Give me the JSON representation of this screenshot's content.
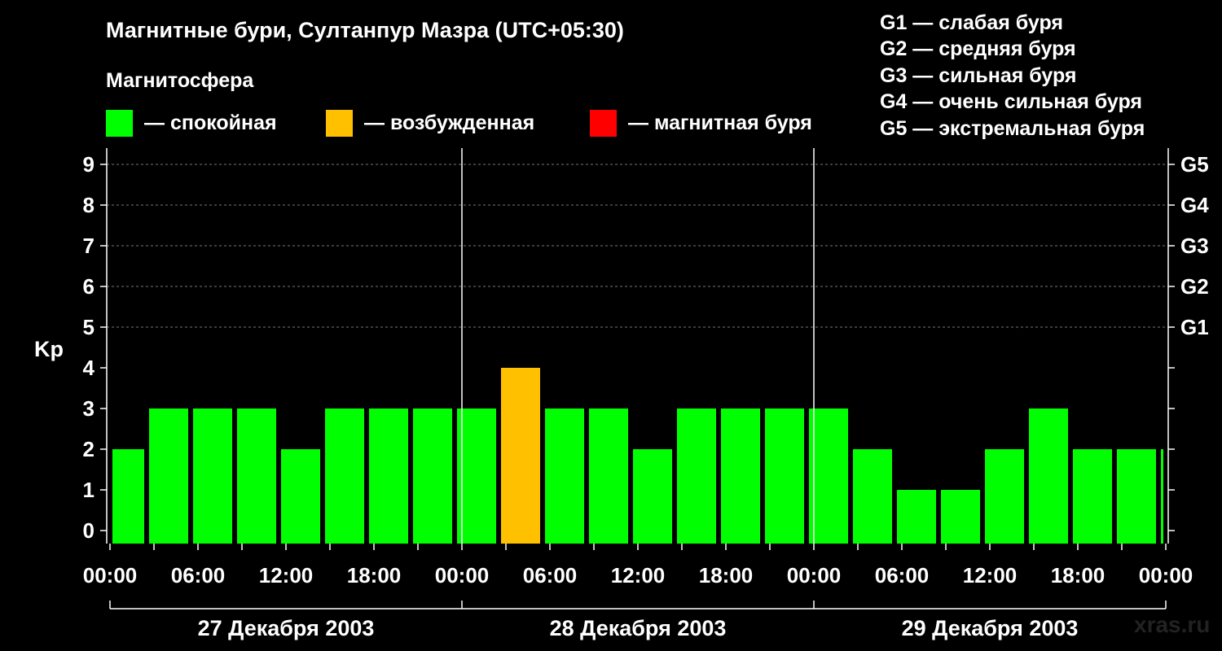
{
  "header": {
    "title": "Магнитные бури, Султанпур Мазра (UTC+05:30)",
    "subtitle": "Магнитосфера"
  },
  "legend": {
    "items": [
      {
        "label": "— спокойная",
        "color": "#00ff00"
      },
      {
        "label": "— возбужденная",
        "color": "#ffc000"
      },
      {
        "label": "— магнитная буря",
        "color": "#ff0000"
      }
    ]
  },
  "g_legend": [
    "G1 — слабая буря",
    "G2 — средняя буря",
    "G3 — сильная буря",
    "G4 — очень сильная буря",
    "G5 — экстремальная буря"
  ],
  "watermark": "xras.ru",
  "chart_data": {
    "type": "bar",
    "ylabel": "Kp",
    "ylim": [
      0,
      9
    ],
    "yticks": [
      "0",
      "1",
      "2",
      "3",
      "4",
      "5",
      "6",
      "7",
      "8",
      "9"
    ],
    "g_scale": [
      {
        "kp": 5,
        "label": "G1"
      },
      {
        "kp": 6,
        "label": "G2"
      },
      {
        "kp": 7,
        "label": "G3"
      },
      {
        "kp": 8,
        "label": "G4"
      },
      {
        "kp": 9,
        "label": "G5"
      }
    ],
    "grid": true,
    "xticks": [
      "00:00",
      "06:00",
      "12:00",
      "18:00",
      "00:00",
      "06:00",
      "12:00",
      "18:00",
      "00:00",
      "06:00",
      "12:00",
      "18:00",
      "00:00"
    ],
    "days": [
      "27 Декабря 2003",
      "28 Декабря 2003",
      "29 Декабря 2003"
    ],
    "colors": {
      "quiet": "#00ff00",
      "active": "#ffc000",
      "storm": "#ff0000"
    },
    "bars": [
      {
        "start_hour": 0.0,
        "end_hour": 2.5,
        "kp": 2,
        "level": "quiet"
      },
      {
        "start_hour": 2.5,
        "end_hour": 5.5,
        "kp": 3,
        "level": "quiet"
      },
      {
        "start_hour": 5.5,
        "end_hour": 8.5,
        "kp": 3,
        "level": "quiet"
      },
      {
        "start_hour": 8.5,
        "end_hour": 11.5,
        "kp": 3,
        "level": "quiet"
      },
      {
        "start_hour": 11.5,
        "end_hour": 14.5,
        "kp": 2,
        "level": "quiet"
      },
      {
        "start_hour": 14.5,
        "end_hour": 17.5,
        "kp": 3,
        "level": "quiet"
      },
      {
        "start_hour": 17.5,
        "end_hour": 20.5,
        "kp": 3,
        "level": "quiet"
      },
      {
        "start_hour": 20.5,
        "end_hour": 23.5,
        "kp": 3,
        "level": "quiet"
      },
      {
        "start_hour": 23.5,
        "end_hour": 26.5,
        "kp": 3,
        "level": "quiet"
      },
      {
        "start_hour": 26.5,
        "end_hour": 29.5,
        "kp": 4,
        "level": "active"
      },
      {
        "start_hour": 29.5,
        "end_hour": 32.5,
        "kp": 3,
        "level": "quiet"
      },
      {
        "start_hour": 32.5,
        "end_hour": 35.5,
        "kp": 3,
        "level": "quiet"
      },
      {
        "start_hour": 35.5,
        "end_hour": 38.5,
        "kp": 2,
        "level": "quiet"
      },
      {
        "start_hour": 38.5,
        "end_hour": 41.5,
        "kp": 3,
        "level": "quiet"
      },
      {
        "start_hour": 41.5,
        "end_hour": 44.5,
        "kp": 3,
        "level": "quiet"
      },
      {
        "start_hour": 44.5,
        "end_hour": 47.5,
        "kp": 3,
        "level": "quiet"
      },
      {
        "start_hour": 47.5,
        "end_hour": 50.5,
        "kp": 3,
        "level": "quiet"
      },
      {
        "start_hour": 50.5,
        "end_hour": 53.5,
        "kp": 2,
        "level": "quiet"
      },
      {
        "start_hour": 53.5,
        "end_hour": 56.5,
        "kp": 1,
        "level": "quiet"
      },
      {
        "start_hour": 56.5,
        "end_hour": 59.5,
        "kp": 1,
        "level": "quiet"
      },
      {
        "start_hour": 59.5,
        "end_hour": 62.5,
        "kp": 2,
        "level": "quiet"
      },
      {
        "start_hour": 62.5,
        "end_hour": 65.5,
        "kp": 3,
        "level": "quiet"
      },
      {
        "start_hour": 65.5,
        "end_hour": 68.5,
        "kp": 2,
        "level": "quiet"
      },
      {
        "start_hour": 68.5,
        "end_hour": 71.5,
        "kp": 2,
        "level": "quiet"
      },
      {
        "start_hour": 71.5,
        "end_hour": 72.0,
        "kp": 2,
        "level": "quiet"
      }
    ]
  }
}
